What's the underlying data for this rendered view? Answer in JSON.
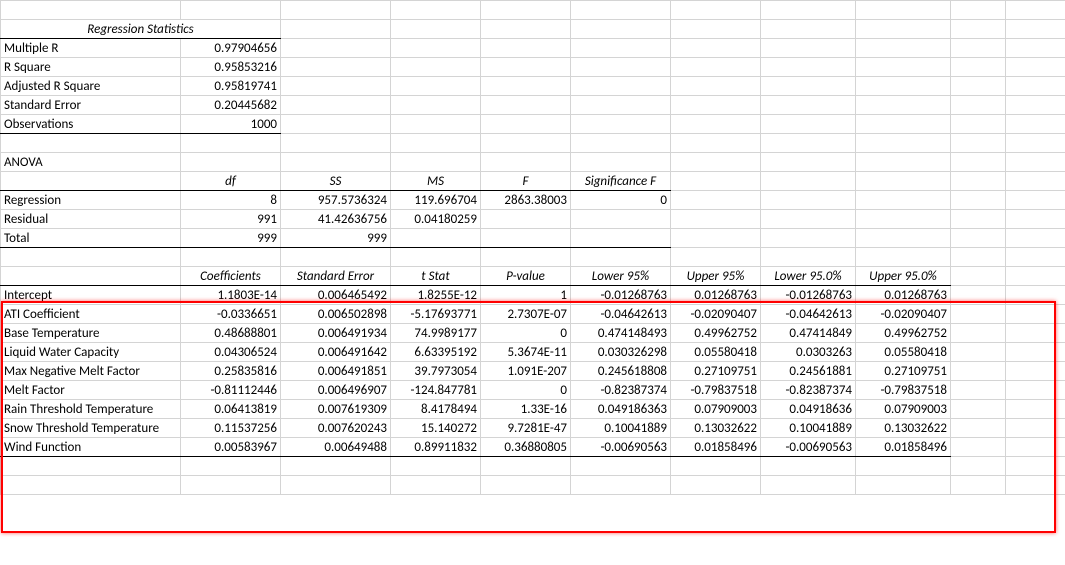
{
  "regStatsHeader": "Regression Statistics",
  "regStats": {
    "rows": [
      {
        "label": "Multiple R",
        "value": "0.97904656"
      },
      {
        "label": "R Square",
        "value": "0.95853216"
      },
      {
        "label": "Adjusted R Square",
        "value": "0.95819741"
      },
      {
        "label": "Standard Error",
        "value": "0.20445682"
      },
      {
        "label": "Observations",
        "value": "1000"
      }
    ]
  },
  "anovaLabel": "ANOVA",
  "anova": {
    "headers": {
      "df": "df",
      "ss": "SS",
      "ms": "MS",
      "f": "F",
      "sigf": "Significance F"
    },
    "rows": [
      {
        "label": "Regression",
        "df": "8",
        "ss": "957.5736324",
        "ms": "119.696704",
        "f": "2863.38003",
        "sigf": "0"
      },
      {
        "label": "Residual",
        "df": "991",
        "ss": "41.42636756",
        "ms": "0.04180259",
        "f": "",
        "sigf": ""
      },
      {
        "label": "Total",
        "df": "999",
        "ss": "999",
        "ms": "",
        "f": "",
        "sigf": ""
      }
    ]
  },
  "coef": {
    "headers": {
      "coefficients": "Coefficients",
      "stderr": "Standard Error",
      "tstat": "t Stat",
      "pvalue": "P-value",
      "lower95": "Lower 95%",
      "upper95": "Upper 95%",
      "lower95b": "Lower 95.0%",
      "upper95b": "Upper 95.0%"
    },
    "rows": [
      {
        "label": "Intercept",
        "c": "1.1803E-14",
        "se": "0.006465492",
        "t": "1.8255E-12",
        "p": "1",
        "l95": "-0.01268763",
        "u95": "0.01268763",
        "l95b": "-0.01268763",
        "u95b": "0.01268763"
      },
      {
        "label": "ATI Coefficient",
        "c": "-0.0336651",
        "se": "0.006502898",
        "t": "-5.17693771",
        "p": "2.7307E-07",
        "l95": "-0.04642613",
        "u95": "-0.02090407",
        "l95b": "-0.04642613",
        "u95b": "-0.02090407"
      },
      {
        "label": "Base Temperature",
        "c": "0.48688801",
        "se": "0.006491934",
        "t": "74.9989177",
        "p": "0",
        "l95": "0.474148493",
        "u95": "0.49962752",
        "l95b": "0.47414849",
        "u95b": "0.49962752"
      },
      {
        "label": "Liquid Water Capacity",
        "c": "0.04306524",
        "se": "0.006491642",
        "t": "6.63395192",
        "p": "5.3674E-11",
        "l95": "0.030326298",
        "u95": "0.05580418",
        "l95b": "0.0303263",
        "u95b": "0.05580418"
      },
      {
        "label": "Max Negative Melt Factor",
        "c": "0.25835816",
        "se": "0.006491851",
        "t": "39.7973054",
        "p": "1.091E-207",
        "l95": "0.245618808",
        "u95": "0.27109751",
        "l95b": "0.24561881",
        "u95b": "0.27109751"
      },
      {
        "label": "Melt Factor",
        "c": "-0.81112446",
        "se": "0.006496907",
        "t": "-124.847781",
        "p": "0",
        "l95": "-0.82387374",
        "u95": "-0.79837518",
        "l95b": "-0.82387374",
        "u95b": "-0.79837518"
      },
      {
        "label": "Rain Threshold Temperature",
        "c": "0.06413819",
        "se": "0.007619309",
        "t": "8.4178494",
        "p": "1.33E-16",
        "l95": "0.049186363",
        "u95": "0.07909003",
        "l95b": "0.04918636",
        "u95b": "0.07909003"
      },
      {
        "label": "Snow Threshold Temperature",
        "c": "0.11537256",
        "se": "0.007620243",
        "t": "15.140272",
        "p": "9.7281E-47",
        "l95": "0.10041889",
        "u95": "0.13032622",
        "l95b": "0.10041889",
        "u95b": "0.13032622"
      },
      {
        "label": "Wind Function",
        "c": "0.00583967",
        "se": "0.00649488",
        "t": "0.89911832",
        "p": "0.36880805",
        "l95": "-0.00690563",
        "u95": "0.01858496",
        "l95b": "-0.00690563",
        "u95b": "0.01858496"
      }
    ]
  }
}
